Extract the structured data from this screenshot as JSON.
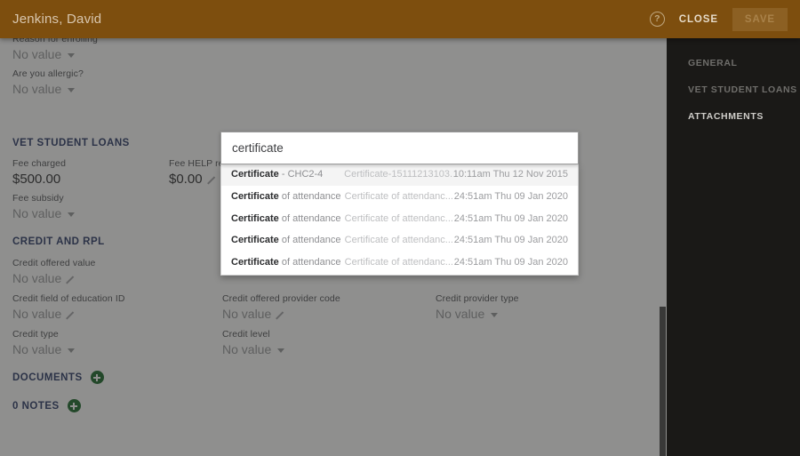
{
  "header": {
    "title": "Jenkins, David",
    "help_icon": "help-circle-icon",
    "close_label": "CLOSE",
    "save_label": "SAVE",
    "background_color": "#7d4e0e"
  },
  "sidebar": {
    "items": [
      {
        "label": "GENERAL",
        "active": false
      },
      {
        "label": "VET STUDENT LOANS",
        "active": false
      },
      {
        "label": "ATTACHMENTS",
        "active": true
      }
    ],
    "background_color": "#1a1917"
  },
  "form": {
    "top_fields": [
      {
        "label": "Reason for enrolling",
        "value": "No value",
        "control": "select"
      },
      {
        "label": "Are you allergic?",
        "value": "No value",
        "control": "select"
      }
    ],
    "sections": [
      {
        "title": "VET STUDENT LOANS"
      },
      {
        "title": "CREDIT AND RPL"
      }
    ],
    "vsl_fields": [
      {
        "label": "Fee charged",
        "value": "$500.00",
        "control": "money"
      },
      {
        "label": "Fee HELP requ",
        "value": "$0.00",
        "control": "edit"
      },
      {
        "label": "Fee subsidy",
        "value": "No value",
        "control": "select"
      }
    ],
    "credit_fields": [
      {
        "label": "Credit offered value",
        "value": "No value",
        "control": "edit"
      },
      {
        "label": "Credit field of education ID",
        "value": "No value",
        "control": "edit"
      },
      {
        "label": "Credit offered provider code",
        "value": "No value",
        "control": "edit"
      },
      {
        "label": "Credit provider type",
        "value": "No value",
        "control": "select"
      },
      {
        "label": "Credit type",
        "value": "No value",
        "control": "select"
      },
      {
        "label": "Credit level",
        "value": "No value",
        "control": "select"
      }
    ],
    "documents": {
      "label": "DOCUMENTS",
      "add_icon": "plus-circle-icon"
    },
    "notes": {
      "label": "0 NOTES",
      "add_icon": "plus-circle-icon"
    },
    "section_color": "#2f3e6b",
    "add_button_color": "#1e6b2e"
  },
  "search": {
    "value": "certificate",
    "placeholder": "",
    "results": [
      {
        "bold": "Certificate",
        "rest": " - CHC2-4",
        "description": "Certificate-15111213103...",
        "timestamp": "10:11am Thu 12 Nov 2015",
        "highlighted": true
      },
      {
        "bold": "Certificate",
        "rest": " of attendance",
        "description": "Certificate of attendanc...",
        "timestamp": "24:51am Thu 09 Jan 2020",
        "highlighted": false
      },
      {
        "bold": "Certificate",
        "rest": " of attendance",
        "description": "Certificate of attendanc...",
        "timestamp": "24:51am Thu 09 Jan 2020",
        "highlighted": false
      },
      {
        "bold": "Certificate",
        "rest": " of attendance",
        "description": "Certificate of attendanc...",
        "timestamp": "24:51am Thu 09 Jan 2020",
        "highlighted": false
      },
      {
        "bold": "Certificate",
        "rest": " of attendance",
        "description": "Certificate of attendanc...",
        "timestamp": "24:51am Thu 09 Jan 2020",
        "highlighted": false
      }
    ]
  }
}
